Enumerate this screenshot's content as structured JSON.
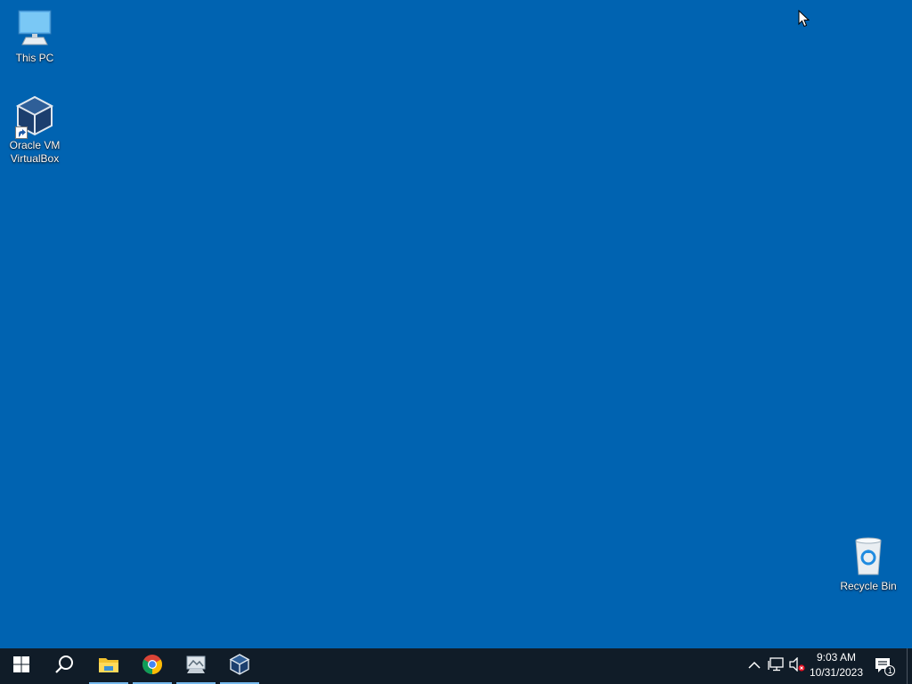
{
  "desktop": {
    "background_color": "#0063b1",
    "icons": [
      {
        "label": "This PC",
        "icon": "this-pc-icon"
      },
      {
        "label": "Oracle VM VirtualBox",
        "icon": "virtualbox-icon"
      },
      {
        "label": "Recycle Bin",
        "icon": "recycle-bin-icon"
      }
    ]
  },
  "taskbar": {
    "background_color": "#101c28",
    "pinned": [
      {
        "name": "start",
        "icon": "windows-logo-icon"
      },
      {
        "name": "search",
        "icon": "search-icon"
      },
      {
        "name": "file-explorer",
        "icon": "folder-icon",
        "active": true
      },
      {
        "name": "chrome",
        "icon": "chrome-icon",
        "active": true
      },
      {
        "name": "image-viewer",
        "icon": "photo-viewer-icon",
        "active": true
      },
      {
        "name": "virtualbox",
        "icon": "virtualbox-icon",
        "active": true
      }
    ],
    "tray": {
      "icons": [
        "chevron-up-icon",
        "network-icon",
        "volume-muted-icon"
      ],
      "time": "9:03 AM",
      "date": "10/31/2023",
      "notification_count": "1"
    }
  }
}
